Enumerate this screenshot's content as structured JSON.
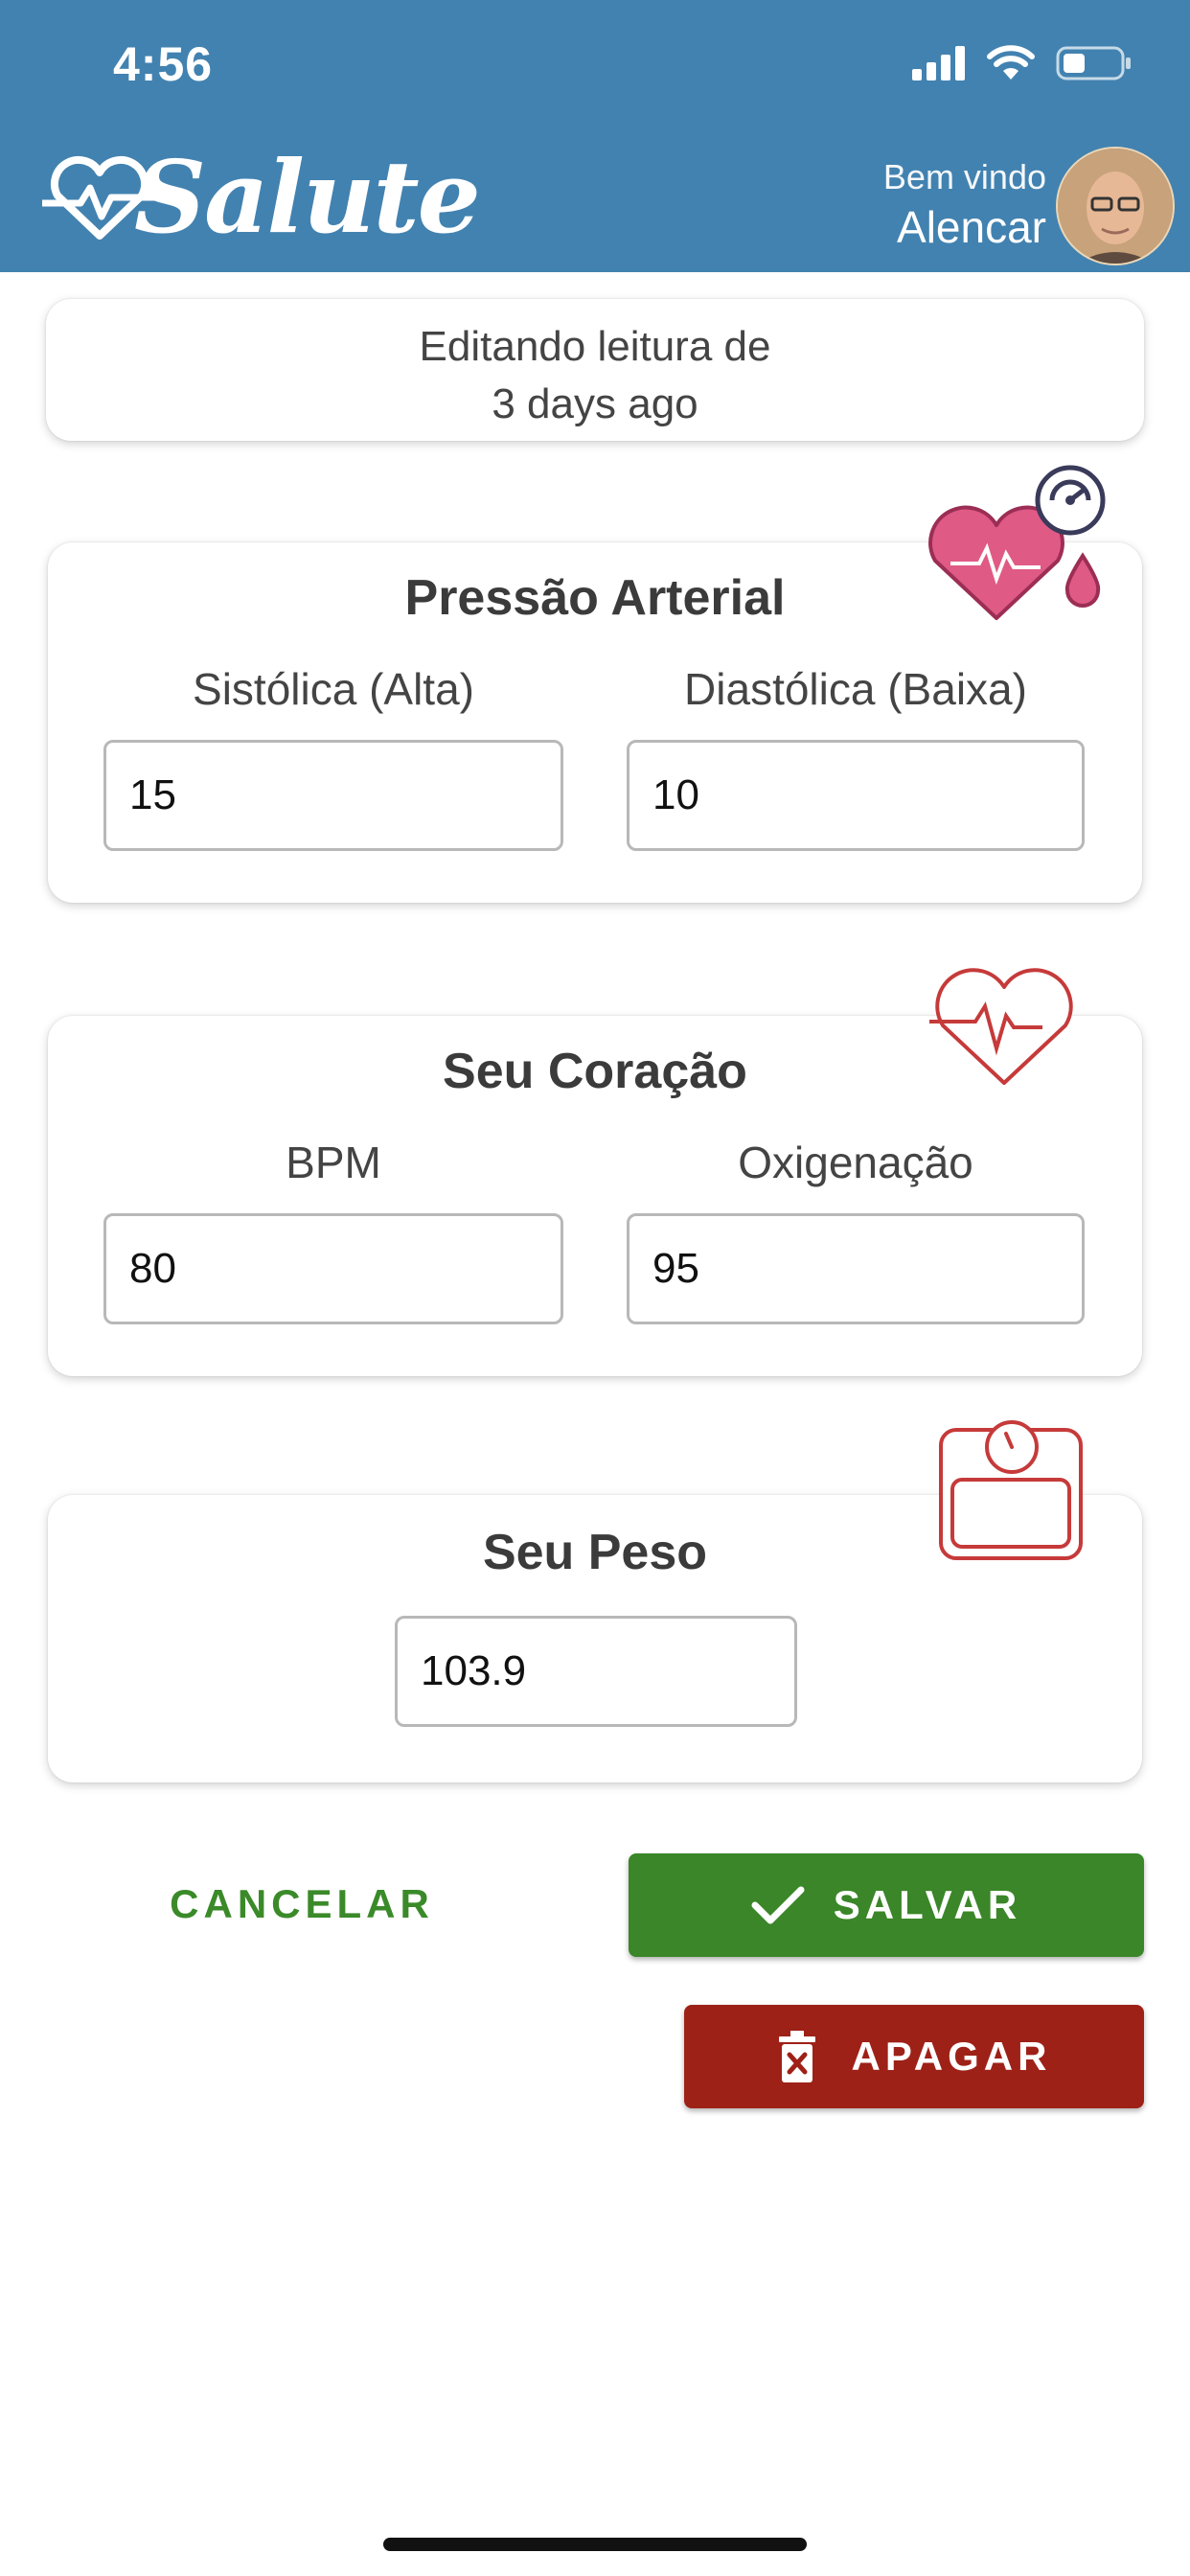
{
  "status_bar": {
    "time": "4:56",
    "icons": [
      "signal-icon",
      "wifi-icon",
      "battery-icon"
    ]
  },
  "header": {
    "app_name": "Salute",
    "welcome_text": "Bem vindo",
    "user_name": "Alencar",
    "background_color": "#4282b0"
  },
  "editing": {
    "line1": "Editando leitura de",
    "line2": "3 days ago"
  },
  "blood_pressure": {
    "title": "Pressão Arterial",
    "systolic_label": "Sistólica (Alta)",
    "systolic_value": "15",
    "diastolic_label": "Diastólica (Baixa)",
    "diastolic_value": "10",
    "icon": "heart-pressure-icon"
  },
  "heart": {
    "title": "Seu Coração",
    "bpm_label": "BPM",
    "bpm_value": "80",
    "oxygen_label": "Oxigenação",
    "oxygen_value": "95",
    "icon": "heart-pulse-icon"
  },
  "weight": {
    "title": "Seu Peso",
    "value": "103.9",
    "icon": "scale-icon"
  },
  "actions": {
    "cancel_label": "CANCELAR",
    "save_label": "SALVAR",
    "delete_label": "APAGAR",
    "save_color": "#3a8628",
    "delete_color": "#9e2117",
    "cancel_color": "#3b8a2a"
  }
}
